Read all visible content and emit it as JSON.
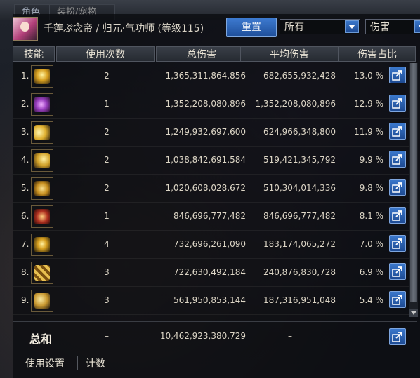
{
  "window": {
    "tabs": [
      "角色",
      "装扮/宠物"
    ]
  },
  "header": {
    "title": "千莲ぷ念帝 / 归元·气功师 (等级115)",
    "reset_label": "重置",
    "filter_select": "所有",
    "metric_select": "伤害"
  },
  "table": {
    "columns": [
      "技能",
      "使用次数",
      "总伤害",
      "平均伤害",
      "伤害占比"
    ],
    "rows": [
      {
        "rank": "1.",
        "uses": "2",
        "total": "1,365,311,864,856",
        "avg": "682,655,932,428",
        "share": "13.0 %",
        "icon": "golden-burst-skill-icon"
      },
      {
        "rank": "2.",
        "uses": "1",
        "total": "1,352,208,080,896",
        "avg": "1,352,208,080,896",
        "share": "12.9 %",
        "icon": "purple-lightning-skill-icon"
      },
      {
        "rank": "3.",
        "uses": "2",
        "total": "1,249,932,697,600",
        "avg": "624,966,348,800",
        "share": "11.9 %",
        "icon": "golden-wave-skill-icon"
      },
      {
        "rank": "4.",
        "uses": "2",
        "total": "1,038,842,691,584",
        "avg": "519,421,345,792",
        "share": "9.9 %",
        "icon": "golden-strike-skill-icon"
      },
      {
        "rank": "5.",
        "uses": "2",
        "total": "1,020,608,028,672",
        "avg": "510,304,014,336",
        "share": "9.8 %",
        "icon": "golden-spiral-skill-icon"
      },
      {
        "rank": "6.",
        "uses": "1",
        "total": "846,696,777,482",
        "avg": "846,696,777,482",
        "share": "8.1 %",
        "icon": "fire-seal-skill-icon"
      },
      {
        "rank": "7.",
        "uses": "4",
        "total": "732,696,261,090",
        "avg": "183,174,065,272",
        "share": "7.0 %",
        "icon": "golden-figure-skill-icon"
      },
      {
        "rank": "8.",
        "uses": "3",
        "total": "722,630,492,184",
        "avg": "240,876,830,728",
        "share": "6.9 %",
        "icon": "golden-sigil-skill-icon"
      },
      {
        "rank": "9.",
        "uses": "3",
        "total": "561,950,853,144",
        "avg": "187,316,951,048",
        "share": "5.4 %",
        "icon": "golden-kick-skill-icon"
      }
    ]
  },
  "totals": {
    "label": "总和",
    "uses": "–",
    "total": "10,462,923,380,729",
    "avg": "–"
  },
  "footer": {
    "tab1": "使用设置",
    "tab2": "计数"
  },
  "colors": {
    "accent_blue": "#2a62b8",
    "gold_icon": "#d8a020",
    "purple_icon": "#9a3fc0",
    "red_icon": "#b03020"
  }
}
